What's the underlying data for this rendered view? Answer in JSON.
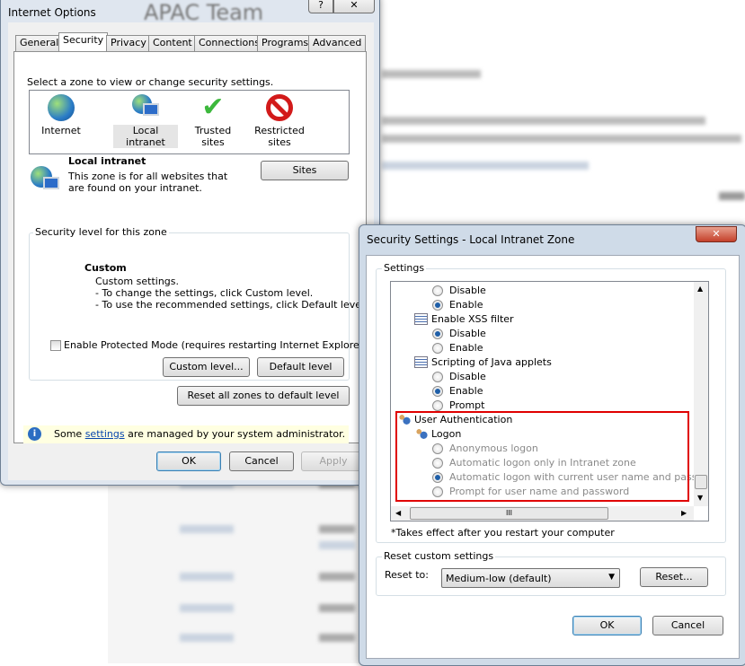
{
  "background": {
    "page_title": "APAC Team"
  },
  "internet_options": {
    "title": "Internet Options",
    "help_label": "?",
    "close_label": "✕",
    "tabs": [
      {
        "label": "General"
      },
      {
        "label": "Security",
        "selected": true
      },
      {
        "label": "Privacy"
      },
      {
        "label": "Content"
      },
      {
        "label": "Connections"
      },
      {
        "label": "Programs"
      },
      {
        "label": "Advanced"
      }
    ],
    "zone_prompt": "Select a zone to view or change security settings.",
    "zones": [
      {
        "label": "Internet",
        "icon": "globe-icon"
      },
      {
        "label": "Local intranet",
        "icon": "intranet-icon",
        "selected": true
      },
      {
        "label": "Trusted sites",
        "icon": "checkmark-icon"
      },
      {
        "label": "Restricted sites",
        "icon": "restricted-icon"
      }
    ],
    "zone_name": "Local intranet",
    "zone_desc": "This zone is for all websites that are found on your intranet.",
    "sites_label": "Sites",
    "level_group": "Security level for this zone",
    "level_name": "Custom",
    "level_lines": [
      "Custom settings.",
      "- To change the settings, click Custom level.",
      "- To use the recommended settings, click Default level."
    ],
    "protected_mode": {
      "label": "Enable Protected Mode (requires restarting Internet Explorer)",
      "checked": false
    },
    "custom_level_label": "Custom level...",
    "default_level_label": "Default level",
    "reset_all_label": "Reset all zones to default level",
    "info_pre": "Some ",
    "info_link": "settings",
    "info_post": " are managed by your system administrator.",
    "ok": "OK",
    "cancel": "Cancel",
    "apply": "Apply"
  },
  "security_settings": {
    "title": "Security Settings - Local Intranet Zone",
    "close_label": "✕",
    "settings_group": "Settings",
    "items": [
      {
        "type": "radio",
        "label": "Disable",
        "checked": false
      },
      {
        "type": "radio",
        "label": "Enable",
        "checked": true
      },
      {
        "type": "header",
        "label": "Enable XSS filter"
      },
      {
        "type": "radio",
        "label": "Disable",
        "checked": true
      },
      {
        "type": "radio",
        "label": "Enable",
        "checked": false
      },
      {
        "type": "header",
        "label": "Scripting of Java applets"
      },
      {
        "type": "radio",
        "label": "Disable",
        "checked": false
      },
      {
        "type": "radio",
        "label": "Enable",
        "checked": true
      },
      {
        "type": "radio",
        "label": "Prompt",
        "checked": false
      },
      {
        "type": "category",
        "label": "User Authentication"
      },
      {
        "type": "subheader",
        "label": "Logon"
      },
      {
        "type": "radio",
        "label": "Anonymous logon",
        "checked": false,
        "disabled": true
      },
      {
        "type": "radio",
        "label": "Automatic logon only in Intranet zone",
        "checked": false,
        "disabled": true
      },
      {
        "type": "radio",
        "label": "Automatic logon with current user name and password",
        "checked": true,
        "disabled": true
      },
      {
        "type": "radio",
        "label": "Prompt for user name and password",
        "checked": false,
        "disabled": true
      }
    ],
    "hscroll_grip": "III",
    "note": "*Takes effect after you restart your computer",
    "reset_group": "Reset custom settings",
    "reset_to_label": "Reset to:",
    "reset_to_value": "Medium-low (default)",
    "reset_button": "Reset...",
    "ok": "OK",
    "cancel": "Cancel",
    "highlight_color": "#e00000"
  }
}
